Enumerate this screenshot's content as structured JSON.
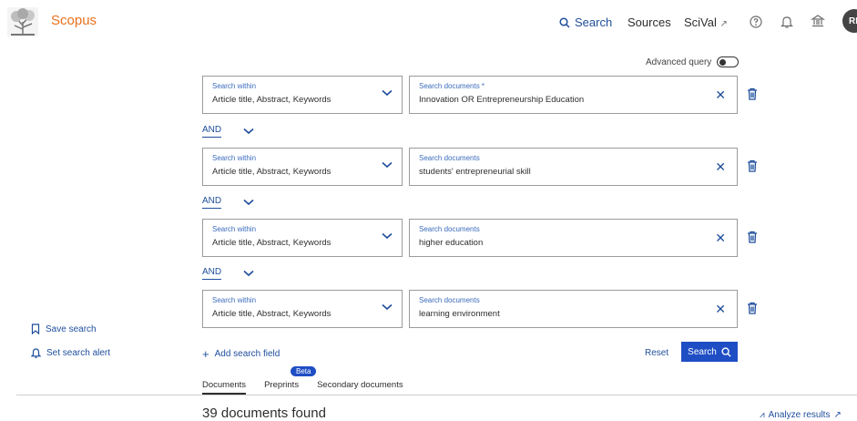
{
  "header": {
    "brand": "Scopus",
    "nav": {
      "search": "Search",
      "sources": "Sources",
      "scival": "SciVal",
      "ext_glyph": "↗"
    },
    "avatar_initials": "RI"
  },
  "advanced_query_label": "Advanced query",
  "fields": [
    {
      "within_label": "Search within",
      "within_value": "Article title, Abstract, Keywords",
      "docs_label": "Search documents *",
      "docs_value": "Innovation OR Entrepreneurship Education"
    },
    {
      "within_label": "Search within",
      "within_value": "Article title, Abstract, Keywords",
      "docs_label": "Search documents",
      "docs_value": "students' entrepreneurial skill"
    },
    {
      "within_label": "Search within",
      "within_value": "Article title, Abstract, Keywords",
      "docs_label": "Search documents",
      "docs_value": "higher education"
    },
    {
      "within_label": "Search within",
      "within_value": "Article title, Abstract, Keywords",
      "docs_label": "Search documents",
      "docs_value": "learning environment"
    }
  ],
  "operators": [
    "AND",
    "AND",
    "AND"
  ],
  "sidebar": {
    "save_search": "Save search",
    "set_alert": "Set search alert"
  },
  "actions": {
    "add_field": "Add search field",
    "reset": "Reset",
    "search": "Search"
  },
  "tabs": {
    "documents": "Documents",
    "preprints": "Preprints",
    "beta": "Beta",
    "secondary": "Secondary documents"
  },
  "results": {
    "found": "39 documents found",
    "analyze": "Analyze results"
  },
  "colors": {
    "brand": "#e9711c",
    "link": "#1f4e9c",
    "primary_button": "#1f4ec4"
  },
  "icons": {
    "clear": "✕",
    "plus": "+",
    "ext": "↗"
  }
}
